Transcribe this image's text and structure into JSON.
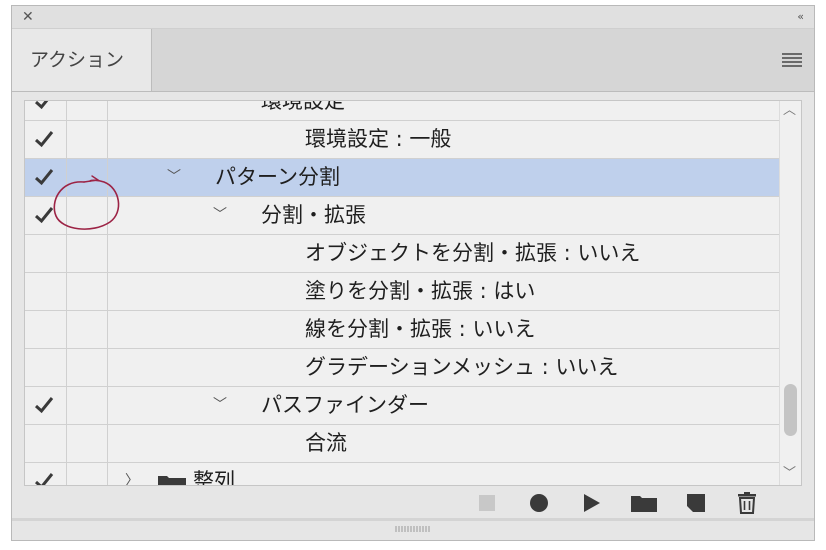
{
  "panel": {
    "tab_label": "アクション"
  },
  "rows": [
    {
      "checked": true,
      "label": "環境設定",
      "level": 2,
      "expandable": true,
      "expanded": true,
      "selected": false
    },
    {
      "checked": true,
      "label": "環境設定 : 一般",
      "level": 3,
      "expandable": false,
      "selected": false
    },
    {
      "checked": true,
      "label": "パターン分割",
      "level": 1,
      "expandable": true,
      "expanded": true,
      "selected": true
    },
    {
      "checked": true,
      "label": "分割・拡張",
      "level": 2,
      "expandable": true,
      "expanded": true,
      "selected": false
    },
    {
      "checked": false,
      "label": "オブジェクトを分割・拡張 : いいえ",
      "level": 3,
      "expandable": false,
      "selected": false
    },
    {
      "checked": false,
      "label": "塗りを分割・拡張 : はい",
      "level": 3,
      "expandable": false,
      "selected": false
    },
    {
      "checked": false,
      "label": "線を分割・拡張 : いいえ",
      "level": 3,
      "expandable": false,
      "selected": false
    },
    {
      "checked": false,
      "label": "グラデーションメッシュ : いいえ",
      "level": 3,
      "expandable": false,
      "selected": false
    },
    {
      "checked": true,
      "label": "パスファインダー",
      "level": 2,
      "expandable": true,
      "expanded": true,
      "selected": false
    },
    {
      "checked": false,
      "label": "合流",
      "level": 3,
      "expandable": false,
      "selected": false
    },
    {
      "checked": true,
      "label": "整列",
      "level": 0,
      "expandable": true,
      "expanded": false,
      "folder": true,
      "selected": false
    }
  ],
  "colors": {
    "selection": "#bfd0ec",
    "annotation": "#9c2345"
  }
}
